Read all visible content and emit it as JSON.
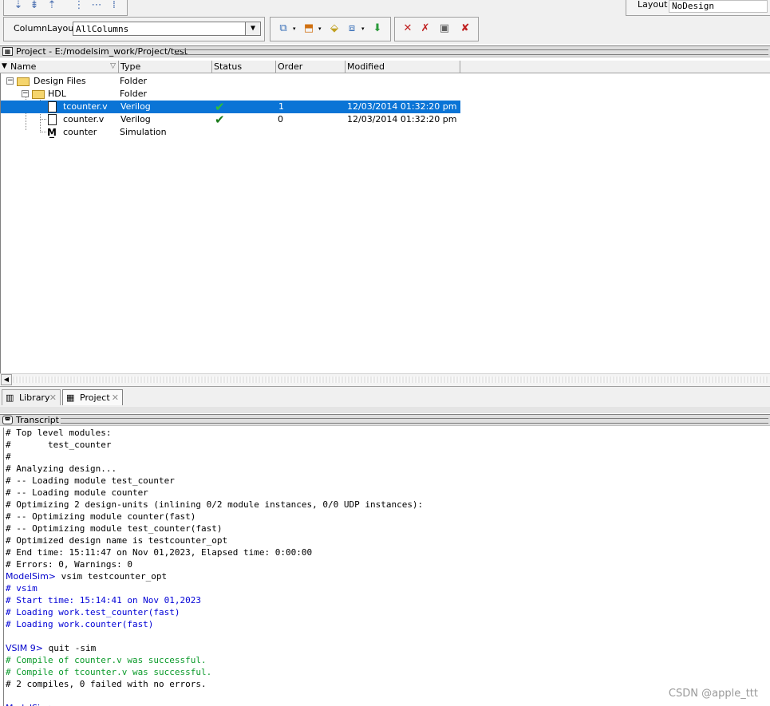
{
  "toolbar": {
    "column_layout_label": "ColumnLayout",
    "column_layout_value": "AllColumns",
    "layout_label": "Layout",
    "layout_value": "NoDesign"
  },
  "project_pane": {
    "title": "Project - E:/modelsim_work/Project/test",
    "columns": [
      "Name",
      "Type",
      "Status",
      "Order",
      "Modified"
    ],
    "rows": [
      {
        "name": "Design Files",
        "type": "Folder",
        "status": "",
        "order": "",
        "modified": "",
        "icon": "folder-icon",
        "expander": "−"
      },
      {
        "name": "HDL",
        "type": "Folder",
        "status": "",
        "order": "",
        "modified": "",
        "icon": "folder-icon",
        "expander": "−"
      },
      {
        "name": "tcounter.v",
        "type": "Verilog",
        "status": "✔",
        "order": "1",
        "modified": "12/03/2014 01:32:20 pm",
        "icon": "file-icon",
        "selected": true
      },
      {
        "name": "counter.v",
        "type": "Verilog",
        "status": "✔",
        "order": "0",
        "modified": "12/03/2014 01:32:20 pm",
        "icon": "file-icon"
      },
      {
        "name": "counter",
        "type": "Simulation",
        "status": "",
        "order": "",
        "modified": "",
        "icon": "simulation-icon"
      }
    ]
  },
  "tabs": [
    {
      "label": "Library"
    },
    {
      "label": "Project"
    }
  ],
  "transcript": {
    "title": "Transcript",
    "lines": [
      {
        "text": "# Top level modules:",
        "color": "#000000"
      },
      {
        "text": "#       test_counter",
        "color": "#000000"
      },
      {
        "text": "#",
        "color": "#000000"
      },
      {
        "text": "# Analyzing design...",
        "color": "#000000"
      },
      {
        "text": "# -- Loading module test_counter",
        "color": "#000000"
      },
      {
        "text": "# -- Loading module counter",
        "color": "#000000"
      },
      {
        "text": "# Optimizing 2 design-units (inlining 0/2 module instances, 0/0 UDP instances):",
        "color": "#000000"
      },
      {
        "text": "# -- Optimizing module counter(fast)",
        "color": "#000000"
      },
      {
        "text": "# -- Optimizing module test_counter(fast)",
        "color": "#000000"
      },
      {
        "text": "# Optimized design name is testcounter_opt",
        "color": "#000000"
      },
      {
        "text": "# End time: 15:11:47 on Nov 01,2023, Elapsed time: 0:00:00",
        "color": "#000000"
      },
      {
        "text": "# Errors: 0, Warnings: 0",
        "color": "#000000"
      },
      {
        "prefix": "ModelSim>",
        "text": " vsim testcounter_opt",
        "color": "#000000"
      },
      {
        "text": "# vsim",
        "color": "#0000d6"
      },
      {
        "text": "# Start time: 15:14:41 on Nov 01,2023",
        "color": "#0000d6"
      },
      {
        "text": "# Loading work.test_counter(fast)",
        "color": "#0000d6"
      },
      {
        "text": "# Loading work.counter(fast)",
        "color": "#0000d6"
      },
      {
        "text": "",
        "color": "#000000"
      },
      {
        "prefix": "VSIM 9>",
        "text": " quit -sim",
        "color": "#000000"
      },
      {
        "text": "# Compile of counter.v was successful.",
        "color": "#0a9a2a"
      },
      {
        "text": "# Compile of tcounter.v was successful.",
        "color": "#0a9a2a"
      },
      {
        "text": "# 2 compiles, 0 failed with no errors.",
        "color": "#000000"
      },
      {
        "text": "",
        "color": "#000000"
      },
      {
        "prefix": "ModelSim>",
        "text": "",
        "color": "#000000"
      }
    ]
  },
  "watermark": "CSDN @apple_ttt"
}
